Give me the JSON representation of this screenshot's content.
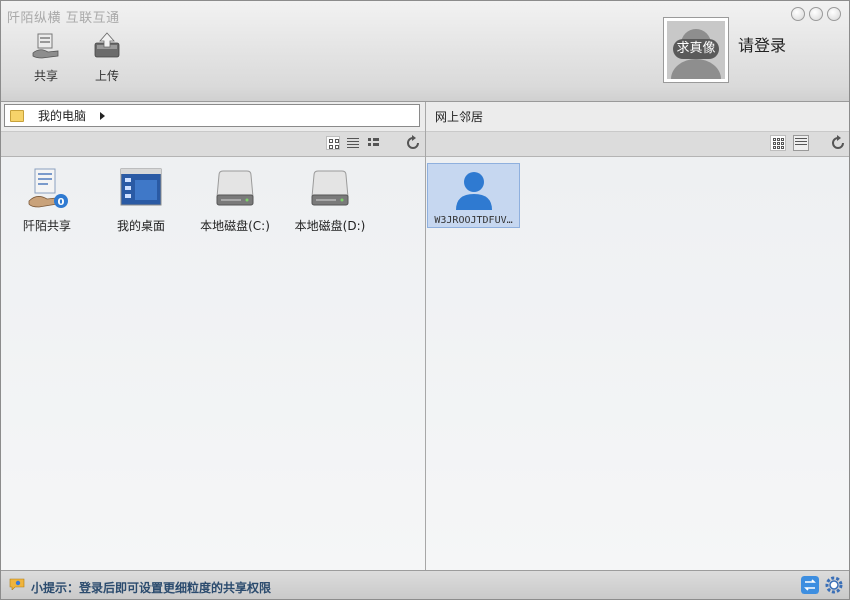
{
  "app": {
    "title": "阡陌纵横 互联互通"
  },
  "toolbar": {
    "share_label": "共享",
    "upload_label": "上传"
  },
  "user": {
    "avatar_tag": "求真像",
    "login_label": "请登录"
  },
  "left_panel": {
    "path": "我的电脑",
    "items": [
      {
        "label": "阡陌共享",
        "badge": "0"
      },
      {
        "label": "我的桌面"
      },
      {
        "label": "本地磁盘(C:)"
      },
      {
        "label": "本地磁盘(D:)"
      }
    ]
  },
  "right_panel": {
    "title": "网上邻居",
    "items": [
      {
        "label": "W3JROOJTDFUV…"
      }
    ]
  },
  "status": {
    "tip": "小提示：登录后即可设置更细粒度的共享权限"
  },
  "colors": {
    "accent": "#2f7ad1",
    "selection": "#c6d7f0",
    "tip_text": "#2b4b6e"
  }
}
